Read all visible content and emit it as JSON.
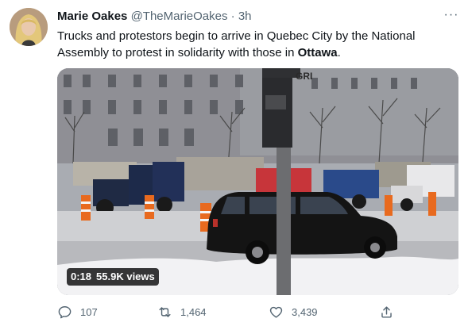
{
  "tweet": {
    "author_name": "Marie Oakes",
    "author_handle": "@TheMarieOakes",
    "separator": "·",
    "timestamp": "3h",
    "more_label": "···",
    "text_before": "Trucks and protestors begin to arrive in Quebec City by the National Assembly to protest in solidarity with those in ",
    "text_bold": "Ottawa",
    "text_after": "."
  },
  "video": {
    "duration": "0:18",
    "views": "55.9K views",
    "sign_text": "GRI"
  },
  "actions": {
    "replies": "107",
    "retweets": "1,464",
    "likes": "3,439"
  },
  "icons": {
    "reply": "reply-icon",
    "retweet": "retweet-icon",
    "like": "heart-icon",
    "share": "share-icon"
  },
  "colors": {
    "text": "#0f1419",
    "secondary": "#536471",
    "badge_bg": "#000000"
  }
}
